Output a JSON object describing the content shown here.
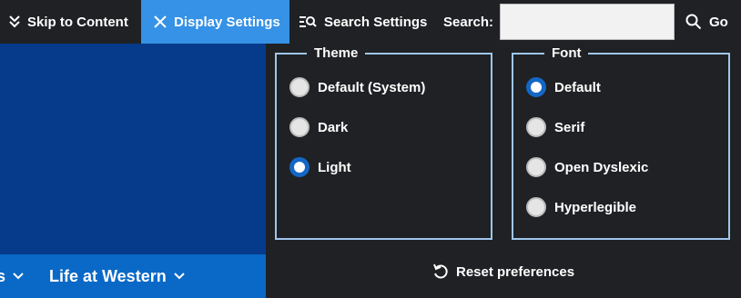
{
  "toolbar": {
    "skip_label": "Skip to Content",
    "display_label": "Display Settings",
    "search_settings_label": "Search Settings",
    "search_label": "Search:",
    "search_value": "",
    "go_label": "Go"
  },
  "nav": {
    "prev_item": "s",
    "life_at_western": "Life at Western"
  },
  "theme": {
    "legend": "Theme",
    "options": [
      {
        "label": "Default (System)",
        "checked": false
      },
      {
        "label": "Dark",
        "checked": false
      },
      {
        "label": "Light",
        "checked": true
      }
    ]
  },
  "font": {
    "legend": "Font",
    "options": [
      {
        "label": "Default",
        "checked": true
      },
      {
        "label": "Serif",
        "checked": false
      },
      {
        "label": "Open Dyslexic",
        "checked": false
      },
      {
        "label": "Hyperlegible",
        "checked": false
      }
    ]
  },
  "reset_label": "Reset preferences",
  "colors": {
    "toolbar_bg": "#1f2124",
    "active_tab": "#3592e6",
    "hero_blue": "#063a8a",
    "nav_blue": "#0a69c7",
    "fieldset_border": "#9fc6ec",
    "radio_selected": "#1467c5"
  }
}
